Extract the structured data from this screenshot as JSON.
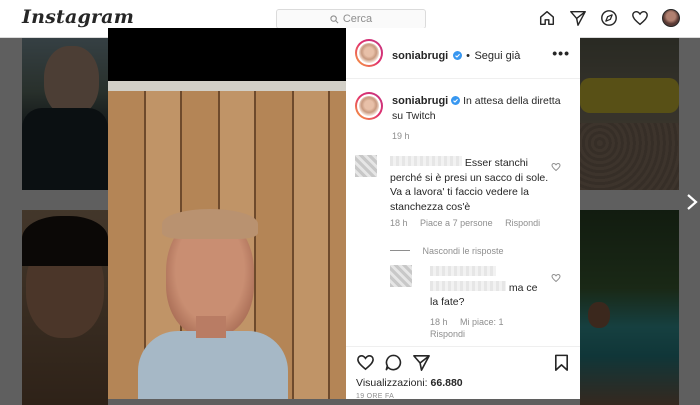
{
  "app": {
    "logo": "Instagram",
    "search_placeholder": "Cerca"
  },
  "nav_icons": [
    "home-icon",
    "direct-icon",
    "explore-icon",
    "activity-heart-icon",
    "profile-avatar"
  ],
  "post": {
    "username": "soniabrugi",
    "follow_status": "Segui già",
    "more_icon": "•••",
    "caption": "In attesa della diretta su Twitch",
    "caption_time": "19 h",
    "views_label": "Visualizzazioni:",
    "views_count": "66.880",
    "post_time": "19 ORE FA"
  },
  "comments": [
    {
      "text": "Esser stanchi perché si è presi un sacco di sole. Va a lavora' ti faccio vedere la stanchezza cos'è",
      "time": "18 h",
      "likes": "Piace a 7 persone",
      "reply_label": "Rispondi"
    }
  ],
  "replies_toggle": "Nascondi le risposte",
  "reply": {
    "text_tail": "ma ce la fate?",
    "time": "18 h",
    "likes": "Mi piace: 1",
    "reply_label": "Rispondi"
  },
  "colors": {
    "accent": "#0095f6",
    "verified": "#3897f0",
    "text": "#262626",
    "secondary": "#8e8e8e"
  }
}
